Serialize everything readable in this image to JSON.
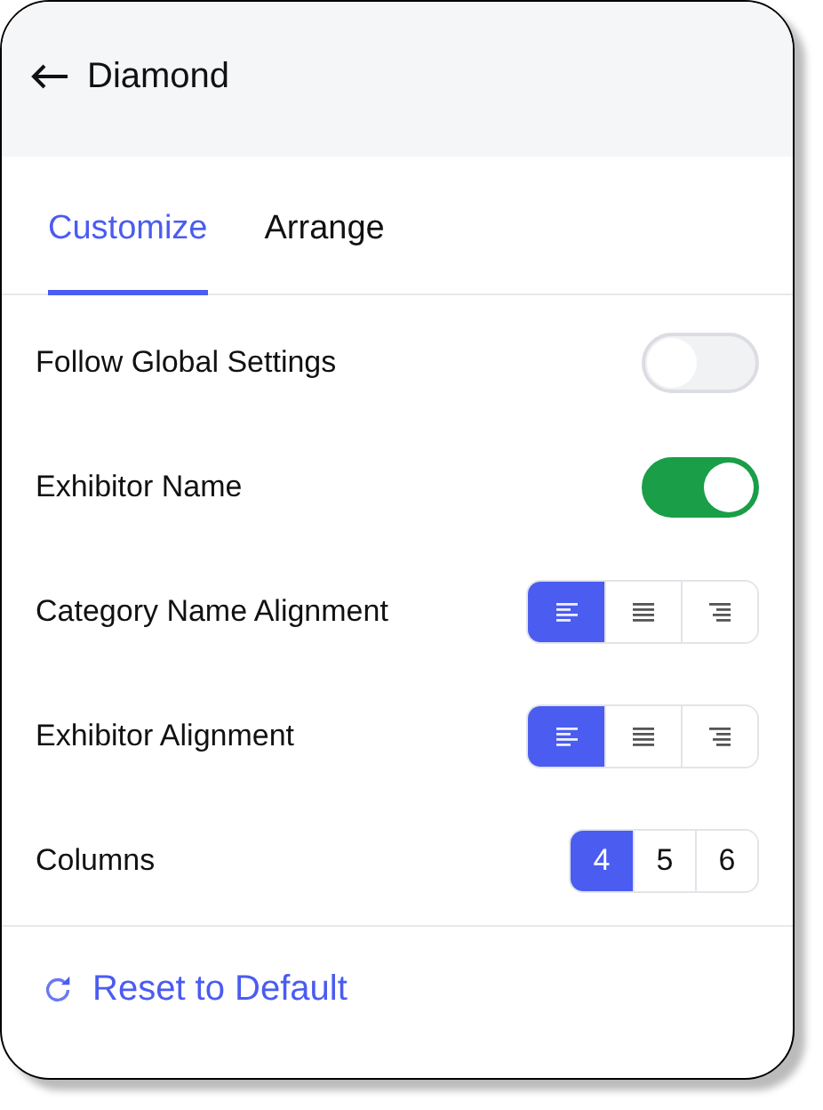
{
  "header": {
    "title": "Diamond"
  },
  "tabs": [
    {
      "label": "Customize",
      "selected": true
    },
    {
      "label": "Arrange",
      "selected": false
    }
  ],
  "settings": [
    {
      "kind": "toggle",
      "label": "Follow Global Settings",
      "on": false
    },
    {
      "kind": "toggle",
      "label": "Exhibitor Name",
      "on": true
    },
    {
      "kind": "segmented",
      "label": "Category Name Alignment",
      "options": [
        {
          "kind": "left",
          "selected": true
        },
        {
          "kind": "center",
          "selected": false
        },
        {
          "kind": "right",
          "selected": false
        }
      ]
    },
    {
      "kind": "segmented",
      "label": "Exhibitor Alignment",
      "options": [
        {
          "kind": "left",
          "selected": true
        },
        {
          "kind": "center",
          "selected": false
        },
        {
          "kind": "right",
          "selected": false
        }
      ]
    },
    {
      "kind": "segmented",
      "label": "Columns",
      "options": [
        {
          "kind": "number",
          "label": "4",
          "selected": true
        },
        {
          "kind": "number",
          "label": "5",
          "selected": false
        },
        {
          "kind": "number",
          "label": "6",
          "selected": false
        }
      ]
    }
  ],
  "reset": {
    "label": "Reset to Default"
  }
}
